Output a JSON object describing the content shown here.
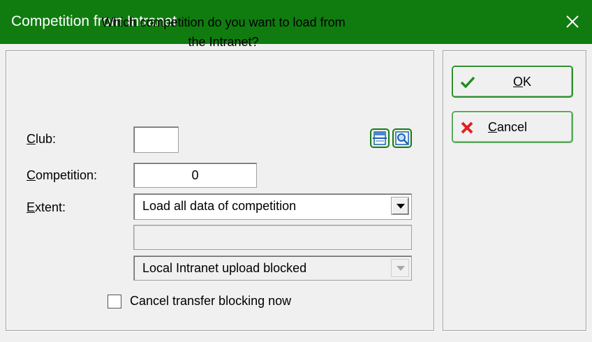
{
  "window": {
    "title": "Competition from Intranet"
  },
  "question": {
    "line1": "Which competition do you want to load from",
    "line2": "the Intranet?"
  },
  "fields": {
    "club": {
      "label_mnemonic": "C",
      "label_rest": "lub:",
      "value": ""
    },
    "competition": {
      "label_mnemonic": "C",
      "label_rest": "ompetition:",
      "value": "0"
    },
    "extent": {
      "label_mnemonic": "E",
      "label_rest": "xtent:",
      "selected": "Load all data of competition"
    },
    "blank_field": {
      "value": ""
    },
    "upload_status": {
      "selected": "Local Intranet upload blocked"
    }
  },
  "checkbox": {
    "label": "Cancel transfer blocking now",
    "checked": false
  },
  "buttons": {
    "ok": {
      "mnemonic": "O",
      "rest": "K",
      "icon": "checkmark-icon"
    },
    "cancel": {
      "mnemonic": "C",
      "rest": "ancel",
      "icon": "x-icon"
    }
  },
  "icons": {
    "list": "list-icon",
    "search": "search-icon",
    "close": "close-icon"
  },
  "colors": {
    "titlebar": "#107c10",
    "ok_check": "#1f8f1f",
    "cancel_x": "#e02020"
  }
}
